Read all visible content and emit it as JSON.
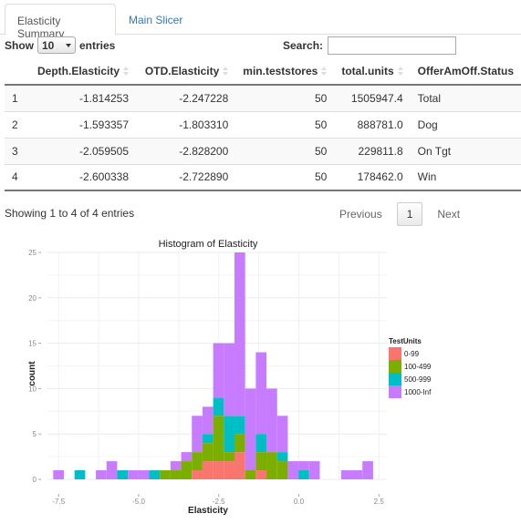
{
  "tabs": [
    {
      "label": "Elasticity Summary",
      "active": true
    },
    {
      "label": "Main Slicer",
      "active": false
    }
  ],
  "length": {
    "show": "Show",
    "value": "10",
    "entries": "entries"
  },
  "search": {
    "label": "Search:",
    "value": ""
  },
  "table": {
    "columns": [
      "",
      "Depth.Elasticity",
      "OTD.Elasticity",
      "min.teststores",
      "total.units",
      "OfferAmOff.Status"
    ],
    "rows": [
      [
        "1",
        "-1.814253",
        "-2.247228",
        "50",
        "1505947.4",
        "Total"
      ],
      [
        "2",
        "-1.593357",
        "-1.803310",
        "50",
        "888781.0",
        "Dog"
      ],
      [
        "3",
        "-2.059505",
        "-2.828200",
        "50",
        "229811.8",
        "On Tgt"
      ],
      [
        "4",
        "-2.600338",
        "-2.722890",
        "50",
        "178462.0",
        "Win"
      ]
    ]
  },
  "info": "Showing 1 to 4 of 4 entries",
  "pager": {
    "previous": "Previous",
    "current": "1",
    "next": "Next"
  },
  "chart_data": {
    "type": "bar",
    "subtype": "stacked-histogram",
    "title": "Histogram of Elasticity",
    "xlabel": "Elasticity",
    "ylabel": "count",
    "xlim": [
      -7.85,
      2.75
    ],
    "ylim": [
      0,
      25
    ],
    "xticks": [
      "-7.5",
      "-5.0",
      "-2.5",
      "0.0",
      "2.5"
    ],
    "yticks": [
      "0",
      "5",
      "10",
      "15",
      "20",
      "25"
    ],
    "legend": {
      "title": "TestUnits",
      "position": "right"
    },
    "bin_width": 0.333,
    "bin_start": -7.67,
    "series": [
      {
        "name": "0-99",
        "color": "#F8766D",
        "values": [
          0,
          0,
          0,
          0,
          0,
          0,
          0,
          0,
          0,
          0,
          0,
          0,
          0,
          1,
          2,
          2,
          2,
          3,
          0,
          1,
          0,
          0,
          0,
          0,
          0,
          0,
          0,
          0,
          0,
          0
        ]
      },
      {
        "name": "100-499",
        "color": "#7CAE00",
        "values": [
          0,
          0,
          0,
          0,
          0,
          0,
          0,
          0,
          0,
          0,
          1,
          1,
          2,
          2,
          2,
          5,
          1,
          2,
          1,
          2,
          3,
          2,
          0,
          0,
          0,
          0,
          0,
          0,
          0,
          0
        ]
      },
      {
        "name": "500-999",
        "color": "#00BFC4",
        "values": [
          0,
          0,
          1,
          0,
          0,
          0,
          1,
          0,
          0,
          1,
          0,
          0,
          0,
          0,
          1,
          2,
          4,
          2,
          0,
          2,
          0,
          1,
          0,
          1,
          0,
          0,
          0,
          0,
          0,
          0
        ]
      },
      {
        "name": "1000-Inf",
        "color": "#C77CFF",
        "values": [
          1,
          0,
          0,
          0,
          1,
          2,
          0,
          1,
          1,
          0,
          0,
          1,
          1,
          4,
          3,
          6,
          8,
          18,
          9,
          9,
          7,
          4,
          2,
          1,
          2,
          0,
          0,
          1,
          1,
          2
        ]
      }
    ]
  }
}
